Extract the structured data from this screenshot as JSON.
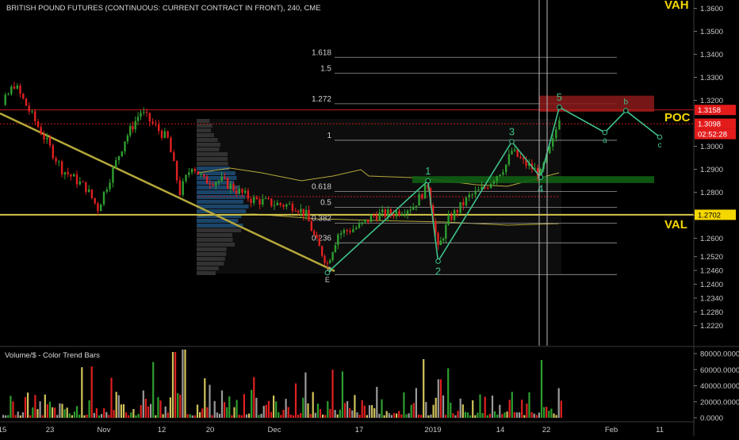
{
  "header": {
    "title": "BRITISH POUND FUTURES (CONTINUOUS: CURRENT CONTRACT IN FRONT), 240, CME"
  },
  "labels": {
    "vah": "VAH",
    "poc": "POC",
    "val": "VAL",
    "volume_indicator": "Volume/$ - Color Trend Bars"
  },
  "price_tags": {
    "top": "1.3158",
    "mid": "1.3098",
    "countdown": "02:52:28",
    "val": "1.2702"
  },
  "colors": {
    "background": "#000000",
    "up_bar": "#2e9e2e",
    "down_bar": "#e02020",
    "neutral_bar": "#9a9a9a",
    "trend_bar": "#d1c35a",
    "wave": "#3ec28a",
    "trendline": "#b5a83a",
    "val_line": "#d4c64a",
    "resistance_zone": "#8b1a1a",
    "support_zone": "#0f5e14",
    "tag_red": "#e31b1b",
    "tag_yellow": "#f5d700"
  },
  "chart_data": [
    {
      "type": "line",
      "title": "BRITISH POUND FUTURES (CONTINUOUS: CURRENT CONTRACT IN FRONT), 240, CME",
      "x_tick_labels": [
        "15",
        "23",
        "Nov",
        "12",
        "20",
        "Dec",
        "17",
        "2019",
        "14",
        "22",
        "Feb",
        "11"
      ],
      "y_tick_labels": [
        "1.3600",
        "1.3500",
        "1.3400",
        "1.3300",
        "1.3200",
        "1.3000",
        "1.2900",
        "1.2800",
        "1.2700",
        "1.2600",
        "1.2520",
        "1.2460",
        "1.2400",
        "1.2340",
        "1.2280",
        "1.2220"
      ],
      "ylim": [
        1.218,
        1.363
      ],
      "grid": false,
      "fibonacci_levels": [
        {
          "label": "1.618",
          "value": 1.3387
        },
        {
          "label": "1.5",
          "value": 1.3318
        },
        {
          "label": "1.272",
          "value": 1.3185
        },
        {
          "label": "1",
          "value": 1.3026
        },
        {
          "label": "0.618",
          "value": 1.2803
        },
        {
          "label": "0.5",
          "value": 1.2734
        },
        {
          "label": "0.382",
          "value": 1.2665
        },
        {
          "label": "0.236",
          "value": 1.258
        },
        {
          "label": "0",
          "value": 1.2442
        }
      ],
      "wave_points": [
        {
          "label": "E",
          "x": "Dec 11",
          "y": 1.245
        },
        {
          "label": "1",
          "x": "Dec 31",
          "y": 1.285
        },
        {
          "label": "2",
          "x": "Jan 2",
          "y": 1.25
        },
        {
          "label": "3",
          "x": "Jan 16",
          "y": 1.302
        },
        {
          "label": "4",
          "x": "Jan 21",
          "y": 1.2865
        },
        {
          "label": "5",
          "x": "Jan 24",
          "y": 1.317
        },
        {
          "label": "a",
          "x": "Jan 31",
          "y": 1.306
        },
        {
          "label": "b",
          "x": "Feb 4",
          "y": 1.3155
        },
        {
          "label": "c",
          "x": "Feb 11",
          "y": 1.304
        }
      ],
      "price_lines": [
        {
          "label": "1.3158",
          "value": 1.3158
        },
        {
          "label": "1.3098",
          "value": 1.3098
        },
        {
          "label": "1.2702",
          "value": 1.2702
        }
      ],
      "zones": [
        {
          "name": "resistance",
          "from": 1.315,
          "to": 1.322
        },
        {
          "name": "support",
          "from": 1.284,
          "to": 1.287
        }
      ],
      "price_path": [
        {
          "x": "Oct 15",
          "y": 1.318
        },
        {
          "x": "Oct 17",
          "y": 1.327
        },
        {
          "x": "Oct 22",
          "y": 1.304
        },
        {
          "x": "Oct 25",
          "y": 1.29
        },
        {
          "x": "Oct 29",
          "y": 1.282
        },
        {
          "x": "Oct 31",
          "y": 1.273
        },
        {
          "x": "Nov 5",
          "y": 1.303
        },
        {
          "x": "Nov 8",
          "y": 1.315
        },
        {
          "x": "Nov 13",
          "y": 1.303
        },
        {
          "x": "Nov 15",
          "y": 1.28
        },
        {
          "x": "Nov 17",
          "y": 1.292
        },
        {
          "x": "Nov 19",
          "y": 1.285
        },
        {
          "x": "Nov 22",
          "y": 1.285
        },
        {
          "x": "Nov 27",
          "y": 1.277
        },
        {
          "x": "Dec 1",
          "y": 1.275
        },
        {
          "x": "Dec 5",
          "y": 1.274
        },
        {
          "x": "Dec 7",
          "y": 1.27
        },
        {
          "x": "Dec 9",
          "y": 1.258
        },
        {
          "x": "Dec 11",
          "y": 1.249
        },
        {
          "x": "Dec 13",
          "y": 1.262
        },
        {
          "x": "Dec 17",
          "y": 1.265
        },
        {
          "x": "Dec 20",
          "y": 1.27
        },
        {
          "x": "Dec 24",
          "y": 1.271
        },
        {
          "x": "Dec 28",
          "y": 1.274
        },
        {
          "x": "Dec 31",
          "y": 1.283
        },
        {
          "x": "Jan 2",
          "y": 1.255
        },
        {
          "x": "Jan 4",
          "y": 1.268
        },
        {
          "x": "Jan 8",
          "y": 1.278
        },
        {
          "x": "Jan 11",
          "y": 1.282
        },
        {
          "x": "Jan 15",
          "y": 1.292
        },
        {
          "x": "Jan 16",
          "y": 1.298
        },
        {
          "x": "Jan 18",
          "y": 1.293
        },
        {
          "x": "Jan 21",
          "y": 1.288
        },
        {
          "x": "Jan 23",
          "y": 1.302
        },
        {
          "x": "Jan 24",
          "y": 1.313
        }
      ]
    },
    {
      "type": "bar",
      "title": "Volume/$ - Color Trend Bars",
      "y_tick_labels": [
        "80000.0000",
        "60000.0000",
        "40000.0000",
        "20000.0000",
        "0.0000"
      ],
      "ylim": [
        0,
        95000
      ]
    }
  ]
}
